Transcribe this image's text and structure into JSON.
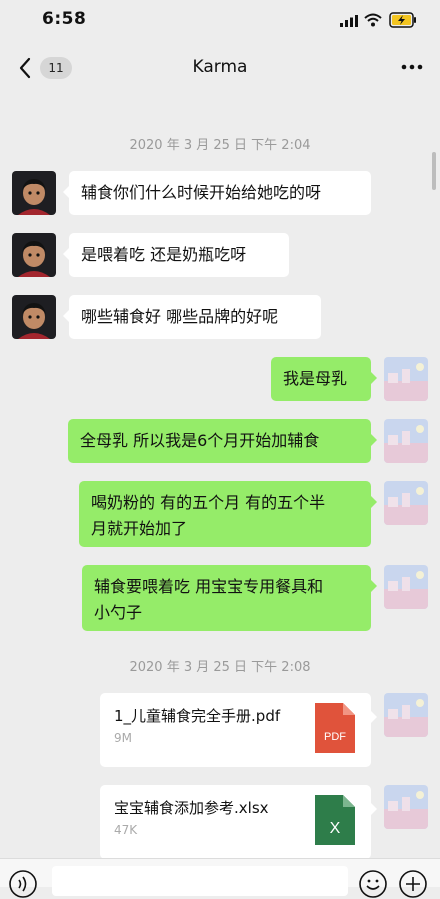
{
  "status": {
    "time": "6:58"
  },
  "header": {
    "back_count": "11",
    "title": "Karma"
  },
  "messages": [
    {
      "type": "timestamp",
      "text": "2020 年 3 月 25 日  下午 2:04"
    },
    {
      "type": "incoming",
      "text": "辅食你们什么时候开始给她吃的呀"
    },
    {
      "type": "incoming",
      "text": "是喂着吃 还是奶瓶吃呀"
    },
    {
      "type": "incoming",
      "text": "哪些辅食好 哪些品牌的好呢"
    },
    {
      "type": "outgoing",
      "text": "我是母乳"
    },
    {
      "type": "outgoing",
      "text": "全母乳 所以我是6个月开始加辅食"
    },
    {
      "type": "outgoing",
      "lines": [
        "喝奶粉的 有的五个月 有的五个半",
        "月就开始加了"
      ]
    },
    {
      "type": "outgoing",
      "lines": [
        "辅食要喂着吃 用宝宝专用餐具和",
        "小勺子"
      ]
    },
    {
      "type": "timestamp",
      "text": "2020 年 3 月 25 日  下午 2:08"
    },
    {
      "type": "file",
      "name": "1_儿童辅食完全手册.pdf",
      "size": "9M",
      "icon_label": "PDF",
      "icon_color": "#e0533b"
    },
    {
      "type": "file",
      "name": "宝宝辅食添加参考.xlsx",
      "size": "47K",
      "icon_label": "X",
      "icon_color": "#2e7d4a"
    }
  ],
  "colors": {
    "background": "#ededed",
    "outgoing_bubble": "#95ec69",
    "incoming_bubble": "#ffffff"
  },
  "icons": [
    "back-chevron-icon",
    "more-icon",
    "signal-icon",
    "wifi-icon",
    "battery-charging-icon",
    "voice-icon",
    "emoji-icon",
    "plus-icon"
  ]
}
